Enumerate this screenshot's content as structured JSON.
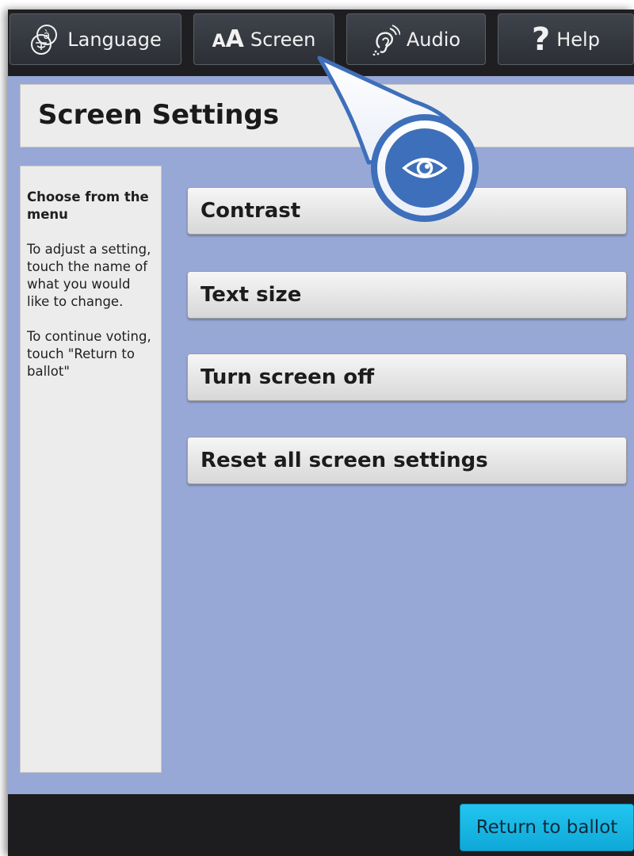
{
  "toolbar": {
    "language_label": "Language",
    "screen_small": "A",
    "screen_big": "A",
    "screen_label": "Screen",
    "audio_label": "Audio",
    "help_mark": "?",
    "help_label": "Help"
  },
  "header": {
    "title": "Screen Settings"
  },
  "sidepanel": {
    "title": "Choose from the menu",
    "paragraphs": [
      "To adjust a setting, touch the name of what you would like to change.",
      "To continue voting, touch \"Return to ballot\""
    ]
  },
  "menu": {
    "items": [
      {
        "label": "Contrast"
      },
      {
        "label": "Text size"
      },
      {
        "label": "Turn screen off"
      },
      {
        "label": "Reset all screen settings"
      }
    ]
  },
  "footer": {
    "return_label": "Return to ballot"
  },
  "icons": {
    "language": "language-icon",
    "audio": "ear-icon",
    "callout": "eye-icon"
  },
  "colors": {
    "background": "#97a7d6",
    "toolbar": "#1f1f22",
    "return_button": "#22c5ef",
    "callout_accent": "#3e6fba"
  }
}
